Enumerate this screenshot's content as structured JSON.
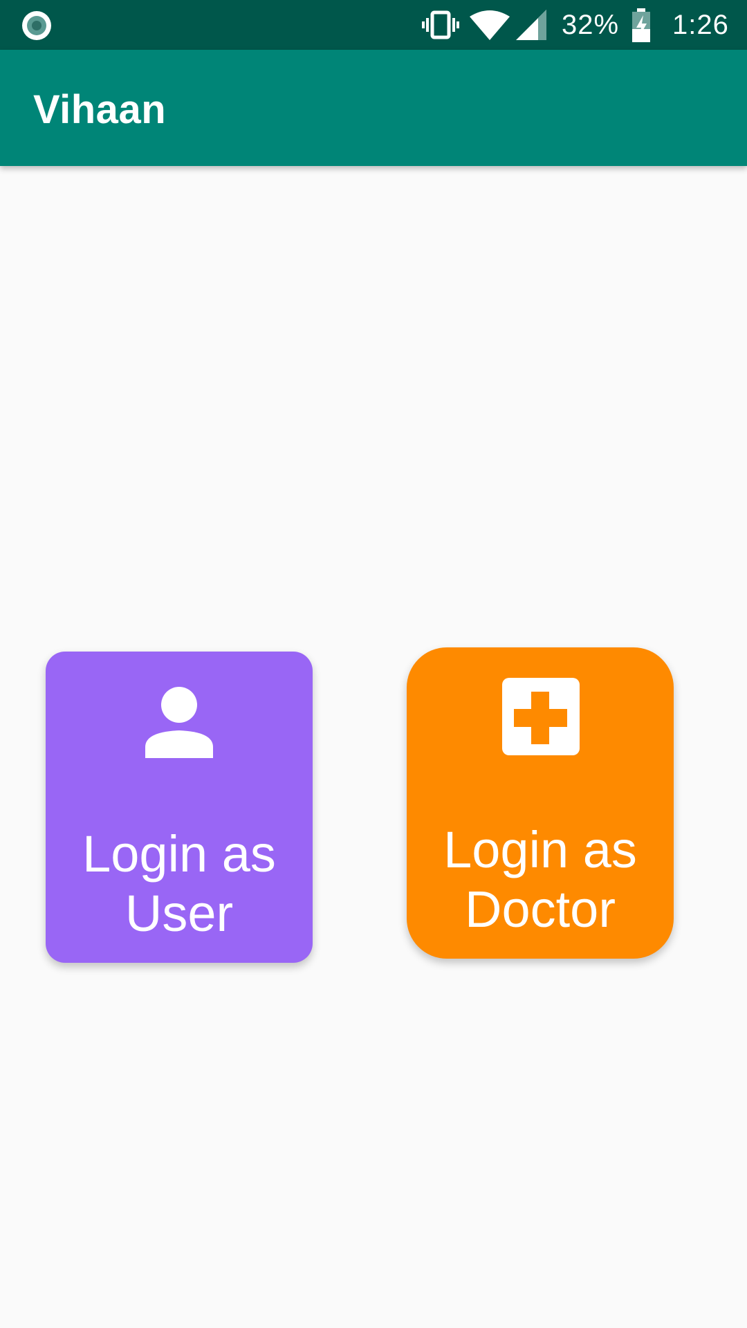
{
  "status_bar": {
    "battery_percent": "32%",
    "time": "1:26",
    "icons": [
      "notification-dot-icon",
      "vibrate-icon",
      "wifi-icon",
      "cell-signal-icon",
      "battery-charging-icon"
    ]
  },
  "app_bar": {
    "title": "Vihaan"
  },
  "cards": {
    "user": {
      "label": "Login as\nUser",
      "icon": "person-icon",
      "color": "#9966f5"
    },
    "doctor": {
      "label": "Login as\nDoctor",
      "icon": "medical-cross-icon",
      "color": "#fe8a00"
    }
  },
  "colors": {
    "status_bar": "#00574b",
    "app_bar": "#008577",
    "background": "#fafafa"
  }
}
